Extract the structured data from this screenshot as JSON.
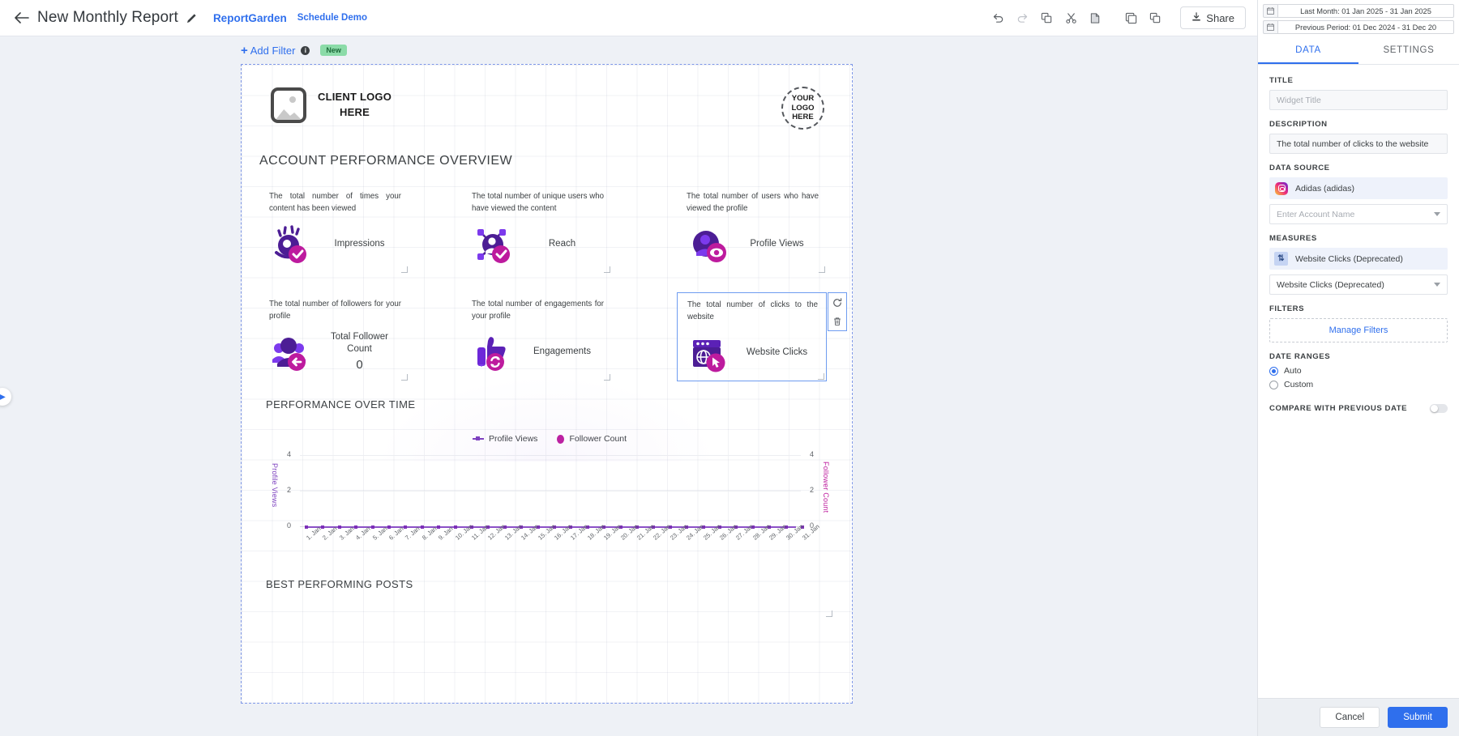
{
  "topbar": {
    "back_icon": "back-arrow-icon",
    "report_title": "New Monthly Report",
    "edit_icon": "pencil-icon",
    "brand_link": "ReportGarden",
    "schedule_link": "Schedule Demo",
    "tools": [
      {
        "name": "undo-icon",
        "glyph": "↺"
      },
      {
        "name": "redo-icon",
        "glyph": "↻"
      },
      {
        "name": "duplicate-icon",
        "glyph": "⧉"
      },
      {
        "name": "cut-icon",
        "glyph": "✂"
      },
      {
        "name": "paste-icon",
        "glyph": "⎘"
      },
      {
        "name": "copy-page-icon",
        "glyph": "◱"
      },
      {
        "name": "duplicate-page-icon",
        "glyph": "⧉"
      }
    ],
    "share_label": "Share",
    "share_icon": "download-icon"
  },
  "filterbar": {
    "add_filter_label": "Add Filter",
    "plus": "+",
    "info_icon": "info-icon",
    "info_glyph": "i",
    "new_badge": "New"
  },
  "date_ranges": {
    "current": "Last Month: 01 Jan 2025 - 31 Jan 2025",
    "previous": "Previous Period: 01 Dec 2024 - 31 Dec 20",
    "calendar_icon": "calendar-icon"
  },
  "report": {
    "header": {
      "client_logo_line1": "CLIENT LOGO",
      "client_logo_line2": "HERE",
      "your_logo_line1": "YOUR",
      "your_logo_line2": "LOGO",
      "your_logo_line3": "HERE"
    },
    "sections": {
      "overview": "ACCOUNT PERFORMANCE OVERVIEW",
      "performance": "PERFORMANCE OVER TIME",
      "posts": "BEST PERFORMING POSTS"
    },
    "kpis": [
      {
        "id": "impressions",
        "description": "The total number of times your content has been viewed",
        "label": "Impressions",
        "value": "",
        "icon": "impressions-eye-icon"
      },
      {
        "id": "reach",
        "description": "The total number of unique users who have viewed the content",
        "label": "Reach",
        "value": "",
        "icon": "reach-network-icon"
      },
      {
        "id": "profile-views",
        "description": "The total number of users who have viewed the profile",
        "label": "Profile Views",
        "value": "",
        "icon": "profile-views-icon"
      },
      {
        "id": "total-follower-count",
        "description": "The total number of followers for your profile",
        "label": "Total Follower Count",
        "value": "0",
        "icon": "followers-group-icon"
      },
      {
        "id": "engagements",
        "description": "The total number of engagements for your profile",
        "label": "Engagements",
        "value": "",
        "icon": "engagements-thumbsup-icon"
      },
      {
        "id": "website-clicks",
        "description": "The total number of clicks to the website",
        "label": "Website Clicks",
        "value": "",
        "icon": "website-clicks-browser-icon",
        "selected": true,
        "tools": [
          {
            "name": "refresh-widget-icon",
            "glyph": "↻"
          },
          {
            "name": "delete-widget-icon",
            "glyph": "🗑"
          }
        ]
      }
    ]
  },
  "chart_data": {
    "type": "line",
    "title": "PERFORMANCE OVER TIME",
    "xlabel": "",
    "ylabel": "Profile Views",
    "y2label": "Follower Count",
    "ylim": [
      0,
      4
    ],
    "y2lim": [
      0,
      4
    ],
    "yticks": [
      0,
      2,
      4
    ],
    "y2ticks": [
      0,
      2,
      4
    ],
    "grid": true,
    "legend_position": "top-center",
    "categories": [
      "1. Jan",
      "2. Jan",
      "3. Jan",
      "4. Jan",
      "5. Jan",
      "6. Jan",
      "7. Jan",
      "8. Jan",
      "9. Jan",
      "10. Jan",
      "11. Jan",
      "12. Jan",
      "13. Jan",
      "14. Jan",
      "15. Jan",
      "16. Jan",
      "17. Jan",
      "18. Jan",
      "19. Jan",
      "20. Jan",
      "21. Jan",
      "22. Jan",
      "23. Jan",
      "24. Jan",
      "25. Jan",
      "26. Jan",
      "27. Jan",
      "28. Jan",
      "29. Jan",
      "30. Jan",
      "31. Jan"
    ],
    "series": [
      {
        "name": "Profile Views",
        "color": "#7c3fbf",
        "axis": "left",
        "values": [
          0,
          0,
          0,
          0,
          0,
          0,
          0,
          0,
          0,
          0,
          0,
          0,
          0,
          0,
          0,
          0,
          0,
          0,
          0,
          0,
          0,
          0,
          0,
          0,
          0,
          0,
          0,
          0,
          0,
          0,
          0
        ]
      },
      {
        "name": "Follower Count",
        "color": "#bd1b9e",
        "axis": "right",
        "values": [
          0,
          0,
          0,
          0,
          0,
          0,
          0,
          0,
          0,
          0,
          0,
          0,
          0,
          0,
          0,
          0,
          0,
          0,
          0,
          0,
          0,
          0,
          0,
          0,
          0,
          0,
          0,
          0,
          0,
          0,
          0
        ]
      }
    ]
  },
  "panel": {
    "tabs": [
      {
        "id": "data",
        "label": "DATA",
        "active": true
      },
      {
        "id": "settings",
        "label": "SETTINGS",
        "active": false
      }
    ],
    "title_label": "TITLE",
    "title_placeholder": "Widget Title",
    "title_value": "",
    "description_label": "DESCRIPTION",
    "description_value": "The total number of clicks to the website",
    "data_source_label": "DATA SOURCE",
    "data_source_account": "Adidas (adidas)",
    "data_source_icon": "instagram-icon",
    "account_placeholder": "Enter Account Name",
    "measures_label": "MEASURES",
    "measure_selected": "Website Clicks (Deprecated)",
    "measure_dropdown": "Website Clicks (Deprecated)",
    "measure_icon": "sort-measure-icon",
    "filters_label": "FILTERS",
    "manage_filters": "Manage Filters",
    "date_ranges_label": "DATE RANGES",
    "date_auto": "Auto",
    "date_custom": "Custom",
    "compare_label": "COMPARE WITH PREVIOUS DATE",
    "compare_on": false,
    "cancel_label": "Cancel",
    "submit_label": "Submit"
  },
  "colors": {
    "accent": "#2f6fed",
    "purple": "#5b21b6",
    "magenta": "#bd1b9e",
    "selection": "#6e9cf0"
  }
}
